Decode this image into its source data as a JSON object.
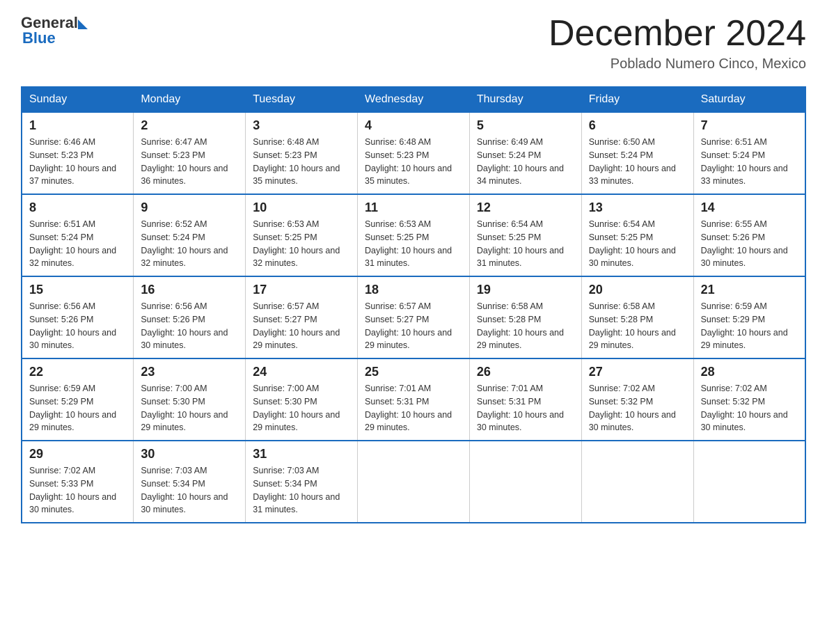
{
  "header": {
    "logo_general": "General",
    "logo_blue": "Blue",
    "month_title": "December 2024",
    "location": "Poblado Numero Cinco, Mexico"
  },
  "calendar": {
    "days_of_week": [
      "Sunday",
      "Monday",
      "Tuesday",
      "Wednesday",
      "Thursday",
      "Friday",
      "Saturday"
    ],
    "weeks": [
      [
        {
          "day": "1",
          "sunrise": "6:46 AM",
          "sunset": "5:23 PM",
          "daylight": "10 hours and 37 minutes."
        },
        {
          "day": "2",
          "sunrise": "6:47 AM",
          "sunset": "5:23 PM",
          "daylight": "10 hours and 36 minutes."
        },
        {
          "day": "3",
          "sunrise": "6:48 AM",
          "sunset": "5:23 PM",
          "daylight": "10 hours and 35 minutes."
        },
        {
          "day": "4",
          "sunrise": "6:48 AM",
          "sunset": "5:23 PM",
          "daylight": "10 hours and 35 minutes."
        },
        {
          "day": "5",
          "sunrise": "6:49 AM",
          "sunset": "5:24 PM",
          "daylight": "10 hours and 34 minutes."
        },
        {
          "day": "6",
          "sunrise": "6:50 AM",
          "sunset": "5:24 PM",
          "daylight": "10 hours and 33 minutes."
        },
        {
          "day": "7",
          "sunrise": "6:51 AM",
          "sunset": "5:24 PM",
          "daylight": "10 hours and 33 minutes."
        }
      ],
      [
        {
          "day": "8",
          "sunrise": "6:51 AM",
          "sunset": "5:24 PM",
          "daylight": "10 hours and 32 minutes."
        },
        {
          "day": "9",
          "sunrise": "6:52 AM",
          "sunset": "5:24 PM",
          "daylight": "10 hours and 32 minutes."
        },
        {
          "day": "10",
          "sunrise": "6:53 AM",
          "sunset": "5:25 PM",
          "daylight": "10 hours and 32 minutes."
        },
        {
          "day": "11",
          "sunrise": "6:53 AM",
          "sunset": "5:25 PM",
          "daylight": "10 hours and 31 minutes."
        },
        {
          "day": "12",
          "sunrise": "6:54 AM",
          "sunset": "5:25 PM",
          "daylight": "10 hours and 31 minutes."
        },
        {
          "day": "13",
          "sunrise": "6:54 AM",
          "sunset": "5:25 PM",
          "daylight": "10 hours and 30 minutes."
        },
        {
          "day": "14",
          "sunrise": "6:55 AM",
          "sunset": "5:26 PM",
          "daylight": "10 hours and 30 minutes."
        }
      ],
      [
        {
          "day": "15",
          "sunrise": "6:56 AM",
          "sunset": "5:26 PM",
          "daylight": "10 hours and 30 minutes."
        },
        {
          "day": "16",
          "sunrise": "6:56 AM",
          "sunset": "5:26 PM",
          "daylight": "10 hours and 30 minutes."
        },
        {
          "day": "17",
          "sunrise": "6:57 AM",
          "sunset": "5:27 PM",
          "daylight": "10 hours and 29 minutes."
        },
        {
          "day": "18",
          "sunrise": "6:57 AM",
          "sunset": "5:27 PM",
          "daylight": "10 hours and 29 minutes."
        },
        {
          "day": "19",
          "sunrise": "6:58 AM",
          "sunset": "5:28 PM",
          "daylight": "10 hours and 29 minutes."
        },
        {
          "day": "20",
          "sunrise": "6:58 AM",
          "sunset": "5:28 PM",
          "daylight": "10 hours and 29 minutes."
        },
        {
          "day": "21",
          "sunrise": "6:59 AM",
          "sunset": "5:29 PM",
          "daylight": "10 hours and 29 minutes."
        }
      ],
      [
        {
          "day": "22",
          "sunrise": "6:59 AM",
          "sunset": "5:29 PM",
          "daylight": "10 hours and 29 minutes."
        },
        {
          "day": "23",
          "sunrise": "7:00 AM",
          "sunset": "5:30 PM",
          "daylight": "10 hours and 29 minutes."
        },
        {
          "day": "24",
          "sunrise": "7:00 AM",
          "sunset": "5:30 PM",
          "daylight": "10 hours and 29 minutes."
        },
        {
          "day": "25",
          "sunrise": "7:01 AM",
          "sunset": "5:31 PM",
          "daylight": "10 hours and 29 minutes."
        },
        {
          "day": "26",
          "sunrise": "7:01 AM",
          "sunset": "5:31 PM",
          "daylight": "10 hours and 30 minutes."
        },
        {
          "day": "27",
          "sunrise": "7:02 AM",
          "sunset": "5:32 PM",
          "daylight": "10 hours and 30 minutes."
        },
        {
          "day": "28",
          "sunrise": "7:02 AM",
          "sunset": "5:32 PM",
          "daylight": "10 hours and 30 minutes."
        }
      ],
      [
        {
          "day": "29",
          "sunrise": "7:02 AM",
          "sunset": "5:33 PM",
          "daylight": "10 hours and 30 minutes."
        },
        {
          "day": "30",
          "sunrise": "7:03 AM",
          "sunset": "5:34 PM",
          "daylight": "10 hours and 30 minutes."
        },
        {
          "day": "31",
          "sunrise": "7:03 AM",
          "sunset": "5:34 PM",
          "daylight": "10 hours and 31 minutes."
        },
        null,
        null,
        null,
        null
      ]
    ]
  }
}
